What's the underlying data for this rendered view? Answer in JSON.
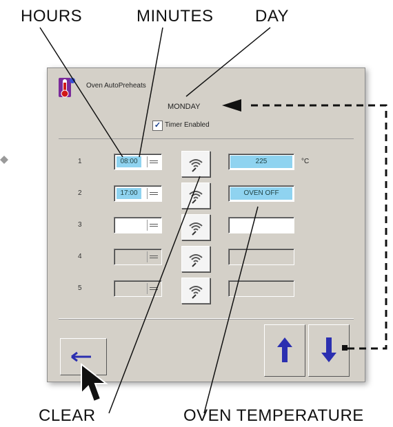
{
  "callouts": {
    "hours": "HOURS",
    "minutes": "MINUTES",
    "day": "DAY",
    "clear": "CLEAR",
    "oven_temperature": "OVEN TEMPERATURE"
  },
  "window": {
    "title": "Oven AutoPreheats",
    "day": "MONDAY",
    "timer_enabled_label": "Timer Enabled",
    "timer_enabled": true
  },
  "rows": [
    {
      "number": "1",
      "time": "08:00",
      "temperature": "225",
      "unit": "°C",
      "active": true
    },
    {
      "number": "2",
      "time": "17:00",
      "temperature": "OVEN OFF",
      "unit": "",
      "active": true
    },
    {
      "number": "3",
      "time": "",
      "temperature": "",
      "unit": "",
      "active": true
    },
    {
      "number": "4",
      "time": "",
      "temperature": "",
      "unit": "",
      "active": false
    },
    {
      "number": "5",
      "time": "",
      "temperature": "",
      "unit": "",
      "active": false
    }
  ],
  "icons": {
    "app": "thermometer-icon",
    "clear_button": "wifi-wave-icon",
    "back": "back-arrow-icon",
    "up": "up-arrow-icon",
    "down": "down-arrow-icon",
    "cursor": "mouse-pointer-icon"
  },
  "colors": {
    "dialog_bg": "#d4d0c8",
    "field_highlight": "#8fd3f0",
    "arrow_blue": "#2b2fb0"
  }
}
